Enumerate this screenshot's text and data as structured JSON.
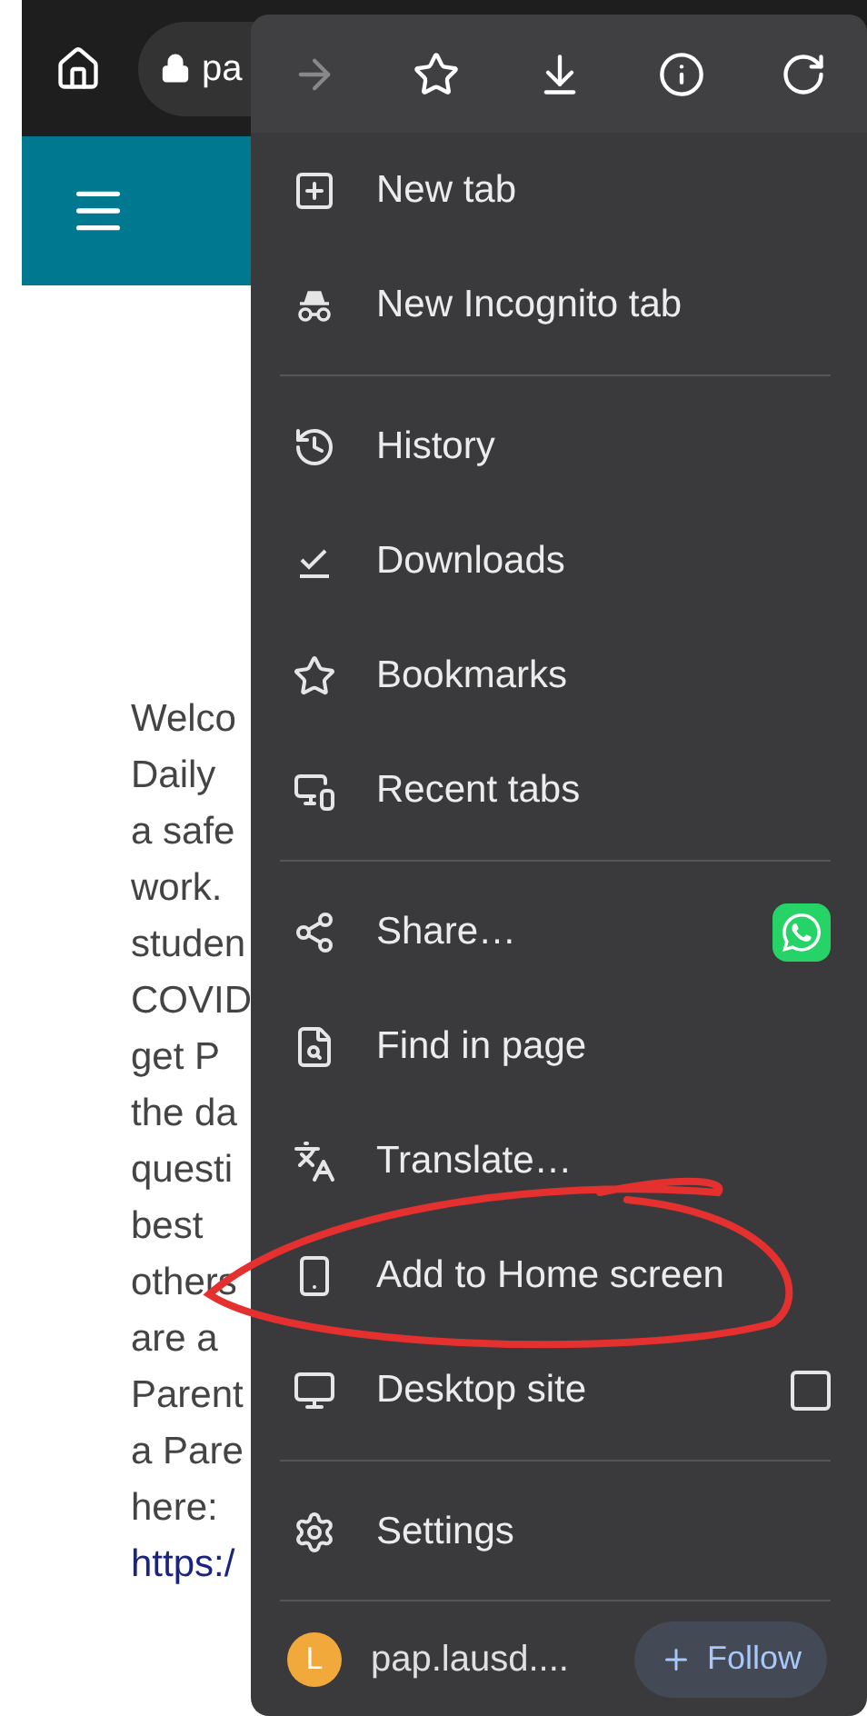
{
  "browser": {
    "url_text": "pa"
  },
  "page": {
    "lines": [
      "Welco",
      "Daily",
      "a safe",
      "work.",
      "studen",
      "COVID",
      "get P",
      "the da",
      "questi",
      "best",
      "others",
      "are a",
      "Parent",
      "a Pare",
      "here:"
    ],
    "link": "https:/"
  },
  "menu": {
    "toolbar": [
      {
        "kind": "forward",
        "disabled": true
      },
      {
        "kind": "bookmark",
        "disabled": false
      },
      {
        "kind": "download",
        "disabled": false
      },
      {
        "kind": "info",
        "disabled": false
      },
      {
        "kind": "reload",
        "disabled": false
      }
    ],
    "sections": [
      [
        {
          "label": "New tab",
          "kind": "plain"
        },
        {
          "label": "New Incognito tab",
          "kind": "plain"
        }
      ],
      [
        {
          "label": "History",
          "kind": "plain"
        },
        {
          "label": "Downloads",
          "kind": "plain"
        },
        {
          "label": "Bookmarks",
          "kind": "plain"
        },
        {
          "label": "Recent tabs",
          "kind": "plain"
        }
      ],
      [
        {
          "label": "Share…",
          "kind": "share"
        },
        {
          "label": "Find in page",
          "kind": "plain"
        },
        {
          "label": "Translate…",
          "kind": "plain"
        },
        {
          "label": "Add to Home screen",
          "kind": "plain"
        },
        {
          "label": "Desktop site",
          "kind": "checkbox",
          "checked": false
        }
      ],
      [
        {
          "label": "Settings",
          "kind": "plain"
        }
      ]
    ],
    "footer": {
      "avatar_letter": "L",
      "site": "pap.lausd....",
      "follow": "Follow"
    }
  }
}
